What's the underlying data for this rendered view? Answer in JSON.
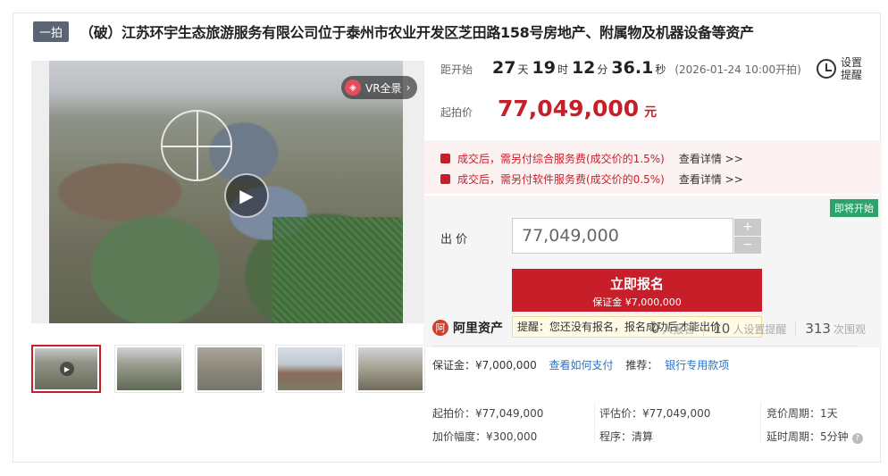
{
  "title": {
    "badge": "一拍",
    "text": "（破）江苏环宇生态旅游服务有限公司位于泰州市农业开发区芝田路158号房地产、附属物及机器设备等资产"
  },
  "media": {
    "vr_label": "VR全景",
    "vr_arrow": "›",
    "play_glyph": "▶"
  },
  "timer": {
    "label": "距开始",
    "days": "27",
    "days_unit": "天",
    "hours": "19",
    "hours_unit": "时",
    "minutes": "12",
    "minutes_unit": "分",
    "seconds": "36.1",
    "seconds_unit": "秒",
    "start_time": "(2026-01-24 10:00开拍)"
  },
  "reminder": {
    "label": "设置提醒"
  },
  "price": {
    "label": "起拍价",
    "value": "77,049,000",
    "unit": "元"
  },
  "fees": [
    {
      "text": "成交后，需另付综合服务费(成交价的1.5%)",
      "link": "查看详情 >>"
    },
    {
      "text": "成交后，需另付软件服务费(成交价的0.5%)",
      "link": "查看详情 >>"
    }
  ],
  "bid": {
    "status_badge": "即将开始",
    "label": "出  价",
    "input_value": "77,049,000",
    "plus": "+",
    "minus": "−",
    "signup_label": "立即报名",
    "deposit_note": "保证金 ¥7,000,000",
    "tip": "提醒：您还没有报名，报名成功后才能出价"
  },
  "platform": {
    "icon_glyph": "阿",
    "name": "阿里资产"
  },
  "stats": [
    {
      "num": "0",
      "label": "人报名"
    },
    {
      "num": "10",
      "label": "人设置提醒"
    },
    {
      "num": "313",
      "label": "次围观"
    }
  ],
  "deposit_row": {
    "label": "保证金：¥7,000,000",
    "pay_link": "查看如何支付",
    "recommend_label": "推荐：",
    "bank_link": "银行专用款项"
  },
  "info": {
    "start_price": "起拍价：¥77,049,000",
    "increment": "加价幅度：¥300,000",
    "appraisal": "评估价：¥77,049,000",
    "procedure": "程序：清算",
    "cycle": "竞价周期：1天",
    "extension": "延时周期：5分钟",
    "help_glyph": "?"
  },
  "colors": {
    "accent_red": "#c81e2a",
    "badge_green": "#2ba36a",
    "link_blue": "#2b73c7"
  }
}
